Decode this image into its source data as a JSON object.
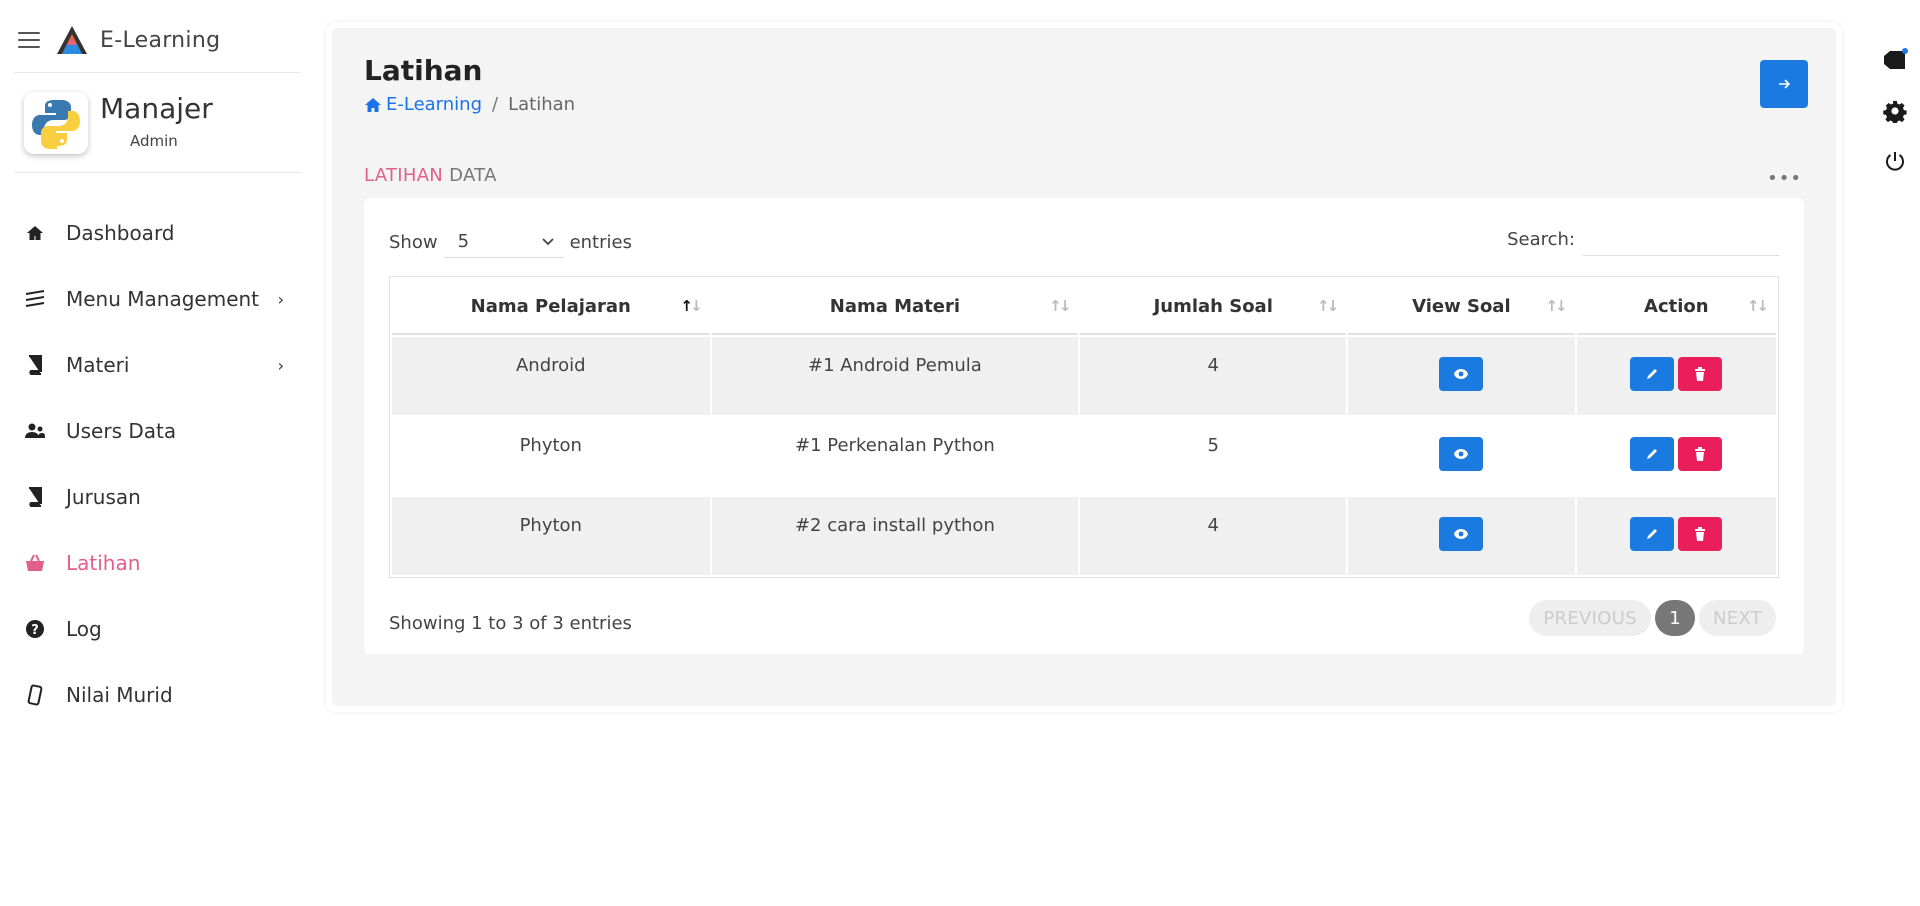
{
  "brand": {
    "name": "E-Learning"
  },
  "profile": {
    "name": "Manajer",
    "role": "Admin"
  },
  "sidebar": {
    "items": [
      {
        "label": "Dashboard",
        "icon": "home-icon"
      },
      {
        "label": "Menu Management",
        "icon": "layers-icon",
        "has_submenu": true
      },
      {
        "label": "Materi",
        "icon": "book-icon",
        "has_submenu": true
      },
      {
        "label": "Users Data",
        "icon": "users-icon"
      },
      {
        "label": "Jurusan",
        "icon": "book-icon"
      },
      {
        "label": "Latihan",
        "icon": "basket-icon",
        "active": true
      },
      {
        "label": "Log",
        "icon": "question-circle-icon"
      },
      {
        "label": "Nilai Murid",
        "icon": "phone-icon"
      }
    ]
  },
  "page": {
    "title": "Latihan",
    "breadcrumb": {
      "home": "E-Learning",
      "separator": "/",
      "current": "Latihan"
    }
  },
  "section": {
    "title_highlight": "LATIHAN",
    "title_rest": "DATA",
    "menu": "•••"
  },
  "table_controls": {
    "show_label": "Show",
    "entries_value": "5",
    "entries_label": "entries",
    "search_label": "Search:",
    "search_value": ""
  },
  "table": {
    "columns": [
      "Nama Pelajaran",
      "Nama Materi",
      "Jumlah Soal",
      "View Soal",
      "Action"
    ],
    "sorted_column": "Nama Pelajaran",
    "rows": [
      {
        "pelajaran": "Android",
        "materi": "#1 Android Pemula",
        "jumlah": "4"
      },
      {
        "pelajaran": "Phyton",
        "materi": "#1 Perkenalan Python",
        "jumlah": "5"
      },
      {
        "pelajaran": "Phyton",
        "materi": "#2 cara install python",
        "jumlah": "4"
      }
    ]
  },
  "footer": {
    "info": "Showing 1 to 3 of 3 entries",
    "previous": "PREVIOUS",
    "page": "1",
    "next": "NEXT"
  },
  "colors": {
    "accent_pink": "#e0608a",
    "primary_blue": "#1a7ae0",
    "danger_red": "#e91e5a"
  },
  "right_rail": [
    "tag-icon",
    "gear-icon",
    "power-icon"
  ]
}
